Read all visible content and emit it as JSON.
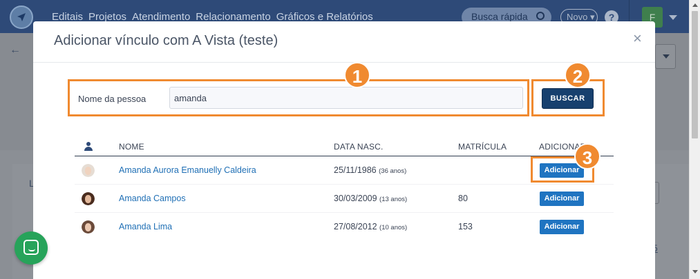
{
  "app": {
    "logo_letter": "",
    "nav": [
      "Editais",
      "Projetos",
      "Atendimento",
      "Relacionamento",
      "Gráficos e Relatórios"
    ],
    "search_placeholder": "Busca rápida",
    "novo_label": "Novo",
    "help_label": "?",
    "avatar_letter": "F",
    "background_left_text": "L",
    "background_right_text": "5"
  },
  "modal": {
    "title": "Adicionar vínculo com A Vista (teste)",
    "close_label": "×",
    "search_label": "Nome da pessoa",
    "search_value": "amanda",
    "buscar_label": "BUSCAR",
    "callouts": [
      "1",
      "2",
      "3"
    ]
  },
  "table": {
    "headers": {
      "name": "NOME",
      "birth": "DATA NASC.",
      "matricula": "MATRÍCULA",
      "add": "ADICIONAR"
    },
    "rows": [
      {
        "name": "Amanda Aurora Emanuelly Caldeira",
        "date": "25/11/1986",
        "age": "(36 anos)",
        "matricula": "",
        "action": "Adicionar"
      },
      {
        "name": "Amanda Campos",
        "date": "30/03/2009",
        "age": "(13 anos)",
        "matricula": "80",
        "action": "Adicionar"
      },
      {
        "name": "Amanda Lima",
        "date": "27/08/2012",
        "age": "(10 anos)",
        "matricula": "153",
        "action": "Adicionar"
      }
    ]
  },
  "colors": {
    "accent": "#f08a30",
    "primary_button": "#17406e",
    "add_button": "#1f74c1",
    "link": "#1f6fb5",
    "chat": "#27a35a"
  }
}
